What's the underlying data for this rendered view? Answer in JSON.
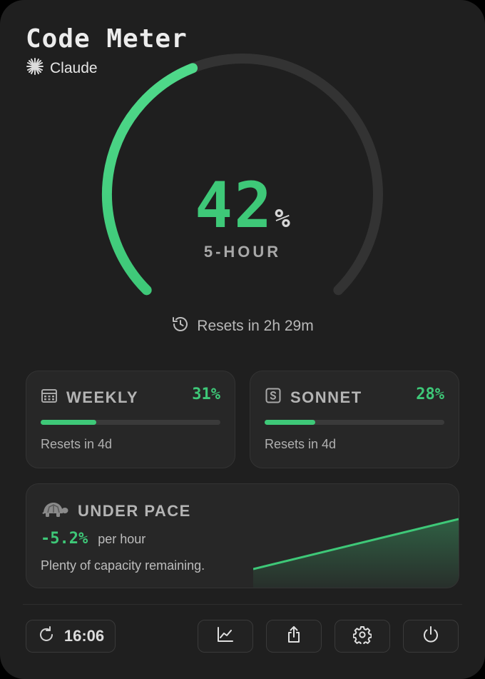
{
  "app": {
    "title": "Code Meter",
    "provider": "Claude"
  },
  "gauge": {
    "percent": 42,
    "value_text": "42",
    "unit": "%",
    "label": "5-HOUR",
    "reset_text": "Resets in 2h 29m",
    "color": "#3ec878"
  },
  "weekly": {
    "label": "WEEKLY",
    "percent_text": "31%",
    "percent": 31,
    "reset_text": "Resets in 4d"
  },
  "sonnet": {
    "label": "SONNET",
    "percent_text": "28%",
    "percent": 28,
    "reset_text": "Resets in 4d"
  },
  "pace": {
    "label": "UNDER PACE",
    "rate_text": "-5.2%",
    "rate_unit": "per hour",
    "message": "Plenty of capacity remaining."
  },
  "footer": {
    "time": "16:06",
    "icons": [
      "refresh-icon",
      "chart-icon",
      "share-icon",
      "gear-icon",
      "power-icon"
    ]
  },
  "colors": {
    "accent": "#3ec878",
    "background": "#1f1f1f",
    "card": "#272727",
    "track": "#333333"
  }
}
